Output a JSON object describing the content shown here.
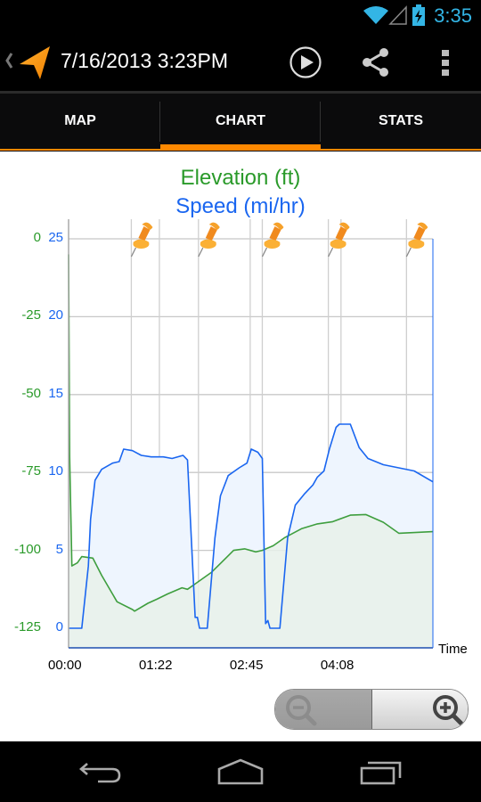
{
  "status_bar": {
    "time": "3:35",
    "icons": [
      "wifi-icon",
      "cell-signal-icon",
      "battery-charging-icon"
    ],
    "accent_color": "#33b5e5"
  },
  "action_bar": {
    "title": "7/16/2013 3:23PM",
    "icons": [
      "up-chevron-icon",
      "navigation-arrow-icon",
      "play-icon",
      "share-icon",
      "overflow-menu-icon"
    ]
  },
  "tabs": [
    {
      "label": "MAP",
      "selected": false
    },
    {
      "label": "CHART",
      "selected": true
    },
    {
      "label": "STATS",
      "selected": false
    }
  ],
  "tab_accent_color": "#ff8800",
  "chart_data": {
    "type": "area",
    "title_lines": [
      {
        "text": "Elevation (ft)",
        "color": "#2a9a2a"
      },
      {
        "text": "Speed (mi/hr)",
        "color": "#1a66f0"
      }
    ],
    "xlabel": "Time",
    "x_tick_labels": [
      "00:00",
      "01:22",
      "02:45",
      "04:08"
    ],
    "x_tick_values": [
      0,
      82.5,
      165,
      247.5
    ],
    "x_range": [
      0,
      331
    ],
    "grid": true,
    "y_axes": [
      {
        "name": "Elevation (ft)",
        "side": "left-outer",
        "color": "#2a9a2a",
        "ticks": [
          0,
          -25,
          -50,
          -75,
          -100,
          -125
        ],
        "range": [
          -131.3,
          0
        ]
      },
      {
        "name": "Speed (mi/hr)",
        "side": "left-inner",
        "color": "#1a66f0",
        "ticks": [
          25,
          20,
          15,
          10,
          5,
          0
        ],
        "range": [
          -1.26,
          25
        ]
      }
    ],
    "marker_times": [
      57,
      118,
      176,
      236,
      307
    ],
    "extra_gridline_times": [
      82.5,
      165,
      176,
      247.5
    ],
    "series": [
      {
        "name": "Speed (mi/hr)",
        "axis": "Speed (mi/hr)",
        "color": "#1a66f0",
        "fill": "#eef5fe",
        "points": [
          [
            0,
            0
          ],
          [
            4,
            0
          ],
          [
            12,
            0
          ],
          [
            18,
            4
          ],
          [
            20,
            7
          ],
          [
            24,
            9.5
          ],
          [
            30,
            10.2
          ],
          [
            40,
            10.6
          ],
          [
            46,
            10.7
          ],
          [
            50,
            11.5
          ],
          [
            58,
            11.4
          ],
          [
            66,
            11.1
          ],
          [
            75,
            11.0
          ],
          [
            86,
            11.0
          ],
          [
            94,
            10.9
          ],
          [
            104,
            11.1
          ],
          [
            108,
            10.8
          ],
          [
            115,
            0.7
          ],
          [
            117,
            0.7
          ],
          [
            119,
            0
          ],
          [
            126,
            0
          ],
          [
            133,
            5.8
          ],
          [
            138,
            8.5
          ],
          [
            145,
            9.8
          ],
          [
            155,
            10.3
          ],
          [
            162,
            10.6
          ],
          [
            166,
            11.5
          ],
          [
            172,
            11.3
          ],
          [
            176,
            10.9
          ],
          [
            179,
            0.3
          ],
          [
            181,
            0.5
          ],
          [
            183,
            0
          ],
          [
            192,
            0
          ],
          [
            199,
            5.8
          ],
          [
            206,
            7.9
          ],
          [
            214,
            8.6
          ],
          [
            222,
            9.2
          ],
          [
            226,
            9.7
          ],
          [
            232,
            10.1
          ],
          [
            237,
            11.5
          ],
          [
            243,
            12.9
          ],
          [
            246,
            13.1
          ],
          [
            256,
            13.1
          ],
          [
            264,
            11.6
          ],
          [
            272,
            10.9
          ],
          [
            286,
            10.5
          ],
          [
            300,
            10.3
          ],
          [
            314,
            10.1
          ],
          [
            331,
            9.4
          ]
        ]
      },
      {
        "name": "Elevation (ft)",
        "axis": "Elevation (ft)",
        "color": "#3e9e3e",
        "fill": "#e8f1ea",
        "points": [
          [
            0,
            -5
          ],
          [
            1,
            -70
          ],
          [
            3,
            -105
          ],
          [
            8,
            -104
          ],
          [
            12,
            -102
          ],
          [
            22,
            -102.5
          ],
          [
            30,
            -108
          ],
          [
            44,
            -116.5
          ],
          [
            58,
            -119
          ],
          [
            60,
            -119.5
          ],
          [
            72,
            -117
          ],
          [
            80,
            -115.7
          ],
          [
            90,
            -114
          ],
          [
            103,
            -112
          ],
          [
            108,
            -112.5
          ],
          [
            118,
            -110
          ],
          [
            130,
            -107
          ],
          [
            140,
            -103.5
          ],
          [
            150,
            -100
          ],
          [
            160,
            -99.5
          ],
          [
            170,
            -100.5
          ],
          [
            176,
            -100
          ],
          [
            186,
            -98.5
          ],
          [
            196,
            -96
          ],
          [
            212,
            -93
          ],
          [
            226,
            -91.5
          ],
          [
            240,
            -90.8
          ],
          [
            256,
            -88.7
          ],
          [
            270,
            -88.5
          ],
          [
            286,
            -91
          ],
          [
            300,
            -94.5
          ],
          [
            331,
            -94
          ]
        ]
      }
    ]
  },
  "zoom_controls": {
    "zoom_out_enabled": false,
    "zoom_in_enabled": true
  },
  "nav_bar": {
    "icons": [
      "back-icon",
      "home-icon",
      "recents-icon"
    ]
  }
}
